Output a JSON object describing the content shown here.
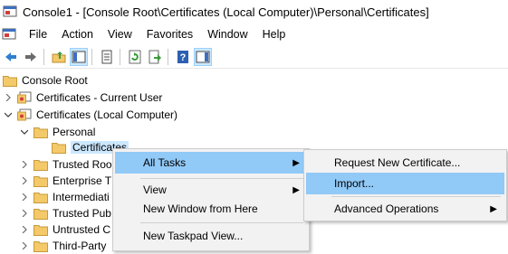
{
  "window": {
    "title": "Console1 - [Console Root\\Certificates (Local Computer)\\Personal\\Certificates]"
  },
  "menubar": {
    "items": [
      "File",
      "Action",
      "View",
      "Favorites",
      "Window",
      "Help"
    ]
  },
  "toolbar": {
    "buttons": [
      "back-arrow-icon",
      "forward-arrow-icon",
      "up-folder-icon",
      "show-hide-tree-icon",
      "properties-icon",
      "refresh-icon",
      "export-list-icon",
      "help-icon",
      "show-hide-action-pane-icon"
    ]
  },
  "tree": {
    "root": "Console Root",
    "current_user": "Certificates - Current User",
    "local_computer": "Certificates (Local Computer)",
    "personal": "Personal",
    "certificates": "Certificates",
    "trusted_root": "Trusted Roo",
    "enterprise_trust": "Enterprise T",
    "intermediate": "Intermediati",
    "trusted_publishers": "Trusted Pub",
    "untrusted": "Untrusted C",
    "third_party": "Third-Party"
  },
  "context_menu": {
    "all_tasks": "All Tasks",
    "view": "View",
    "new_window": "New Window from Here",
    "new_taskpad": "New Taskpad View..."
  },
  "submenu": {
    "request_new": "Request New Certificate...",
    "import": "Import...",
    "advanced": "Advanced Operations"
  },
  "colors": {
    "menu_highlight": "#91c9f7",
    "selection": "#cce8ff",
    "folder": "#f3c969"
  }
}
